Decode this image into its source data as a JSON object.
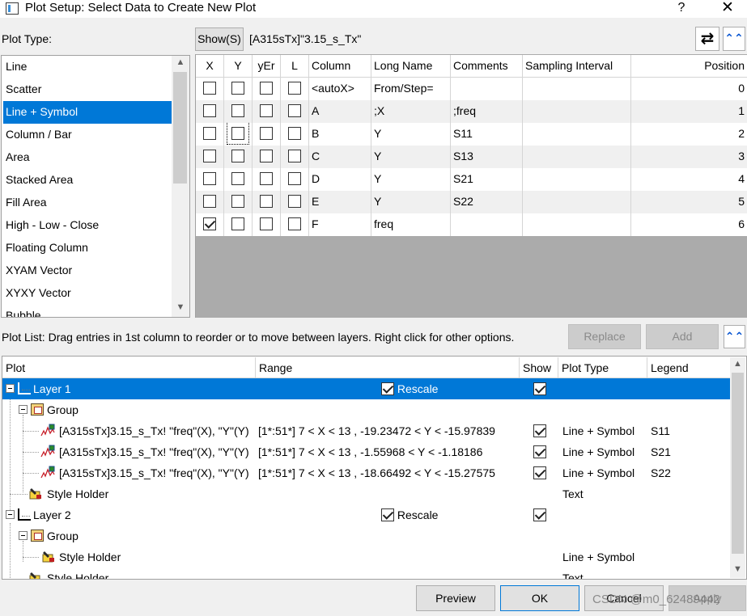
{
  "window": {
    "title": "Plot Setup: Select Data to Create New Plot",
    "help_label": "?",
    "close_label": "✕"
  },
  "plot_type": {
    "label": "Plot Type:",
    "items": [
      "Line",
      "Scatter",
      "Line + Symbol",
      "Column / Bar",
      "Area",
      "Stacked Area",
      "Fill Area",
      "High - Low - Close",
      "Floating Column",
      "XYAM Vector",
      "XYXY Vector",
      "Bubble"
    ],
    "selected": "Line + Symbol"
  },
  "dataset_bar": {
    "show_label": "Show(S)",
    "dataset": "[A315sTx]\"3.15_s_Tx\"",
    "swap_icon": "⇄",
    "collapse_icon": "⌃⌃"
  },
  "columns": {
    "headers": [
      "X",
      "Y",
      "yEr",
      "L",
      "Column",
      "Long Name",
      "Comments",
      "Sampling Interval",
      "Position"
    ],
    "rows": [
      {
        "x": false,
        "y": false,
        "yer": false,
        "l": false,
        "column": "<autoX>",
        "long_name": "From/Step=",
        "comments": "",
        "sampling": "",
        "position": "0"
      },
      {
        "x": false,
        "y": false,
        "yer": false,
        "l": false,
        "column": "A",
        "long_name": ";X",
        "comments": ";freq",
        "sampling": "",
        "position": "1"
      },
      {
        "x": false,
        "y": false,
        "yer": false,
        "l": false,
        "column": "B",
        "long_name": "Y",
        "comments": "S11",
        "sampling": "",
        "position": "2"
      },
      {
        "x": false,
        "y": false,
        "yer": false,
        "l": false,
        "column": "C",
        "long_name": "Y",
        "comments": "S13",
        "sampling": "",
        "position": "3"
      },
      {
        "x": false,
        "y": false,
        "yer": false,
        "l": false,
        "column": "D",
        "long_name": "Y",
        "comments": "S21",
        "sampling": "",
        "position": "4"
      },
      {
        "x": false,
        "y": false,
        "yer": false,
        "l": false,
        "column": "E",
        "long_name": "Y",
        "comments": "S22",
        "sampling": "",
        "position": "5"
      },
      {
        "x": true,
        "y": false,
        "yer": false,
        "l": false,
        "column": "F",
        "long_name": "freq",
        "comments": "",
        "sampling": "",
        "position": "6"
      }
    ]
  },
  "plot_list_bar": {
    "label": "Plot List: Drag entries in 1st column to reorder or to move between layers. Right click for other options.",
    "replace_label": "Replace",
    "add_label": "Add"
  },
  "plot_list": {
    "headers": [
      "Plot",
      "Range",
      "Show",
      "Plot Type",
      "Legend"
    ],
    "layer1": {
      "name": "Layer 1",
      "rescale": "Rescale"
    },
    "group1": {
      "name": "Group"
    },
    "plots": [
      {
        "plot": "[A315sTx]3.15_s_Tx! \"freq\"(X), \"Y\"(Y)",
        "range": "[1*:51*]  7 < X < 13 , -19.23472 < Y < -15.97839",
        "show": true,
        "type": "Line + Symbol",
        "legend": "S11"
      },
      {
        "plot": "[A315sTx]3.15_s_Tx! \"freq\"(X), \"Y\"(Y)",
        "range": "[1*:51*]  7 < X < 13 , -1.55968 < Y < -1.18186",
        "show": true,
        "type": "Line + Symbol",
        "legend": "S21"
      },
      {
        "plot": "[A315sTx]3.15_s_Tx! \"freq\"(X), \"Y\"(Y)",
        "range": "[1*:51*]  7 < X < 13 , -18.66492 < Y < -15.27575",
        "show": true,
        "type": "Line + Symbol",
        "legend": "S22"
      }
    ],
    "style_holder1": {
      "name": "Style Holder",
      "type": "Text"
    },
    "layer2": {
      "name": "Layer 2",
      "rescale": "Rescale"
    },
    "group2": {
      "name": "Group"
    },
    "style_holder2": {
      "name": "Style Holder",
      "type": "Line + Symbol"
    },
    "style_holder3": {
      "name": "Style Holder",
      "type": "Text"
    }
  },
  "buttons": {
    "preview": "Preview",
    "ok": "OK",
    "cancel": "Cancel",
    "apply": "Apply"
  },
  "watermark": "CSDN @m0_62489442",
  "colors": {
    "selection": "#0078d7",
    "accent": "#0050d0"
  }
}
